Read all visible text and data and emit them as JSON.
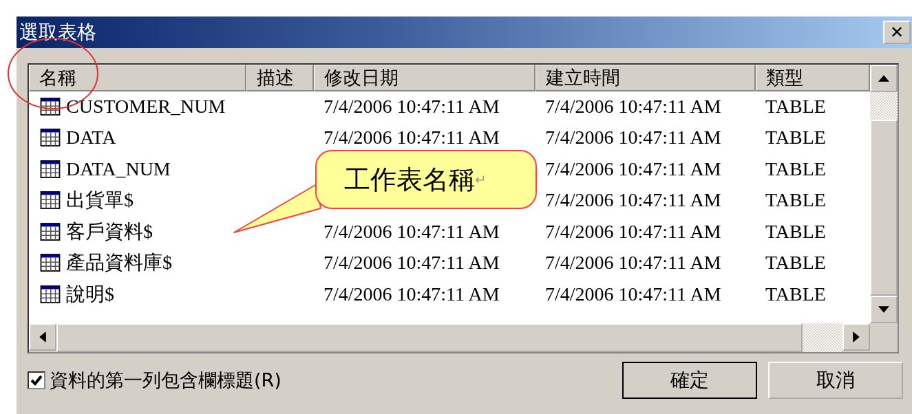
{
  "window": {
    "title": "選取表格",
    "close": "✕"
  },
  "table": {
    "columns": [
      "名稱",
      "描述",
      "修改日期",
      "建立時間",
      "類型"
    ],
    "rows": [
      {
        "name": "CUSTOMER_NUM",
        "modified": "7/4/2006 10:47:11 AM",
        "created": "7/4/2006 10:47:11 AM",
        "type": "TABLE"
      },
      {
        "name": "DATA",
        "modified": "7/4/2006 10:47:11 AM",
        "created": "7/4/2006 10:47:11 AM",
        "type": "TABLE"
      },
      {
        "name": "DATA_NUM",
        "created": "7/4/2006 10:47:11 AM",
        "type": "TABLE"
      },
      {
        "name": "出貨單$",
        "created": "7/4/2006 10:47:11 AM",
        "type": "TABLE"
      },
      {
        "name": "客戶資料$",
        "modified": "7/4/2006 10:47:11 AM",
        "created": "7/4/2006 10:47:11 AM",
        "type": "TABLE"
      },
      {
        "name": "產品資料庫$",
        "modified": "7/4/2006 10:47:11 AM",
        "created": "7/4/2006 10:47:11 AM",
        "type": "TABLE"
      },
      {
        "name": "說明$",
        "modified": "7/4/2006 10:47:11 AM",
        "created": "7/4/2006 10:47:11 AM",
        "type": "TABLE"
      }
    ]
  },
  "callout": {
    "text": "工作表名稱",
    "mark": "↵"
  },
  "checkbox": {
    "label": "資料的第一列包含欄標題(R)",
    "checked": true
  },
  "buttons": [
    "確定",
    "取消"
  ]
}
